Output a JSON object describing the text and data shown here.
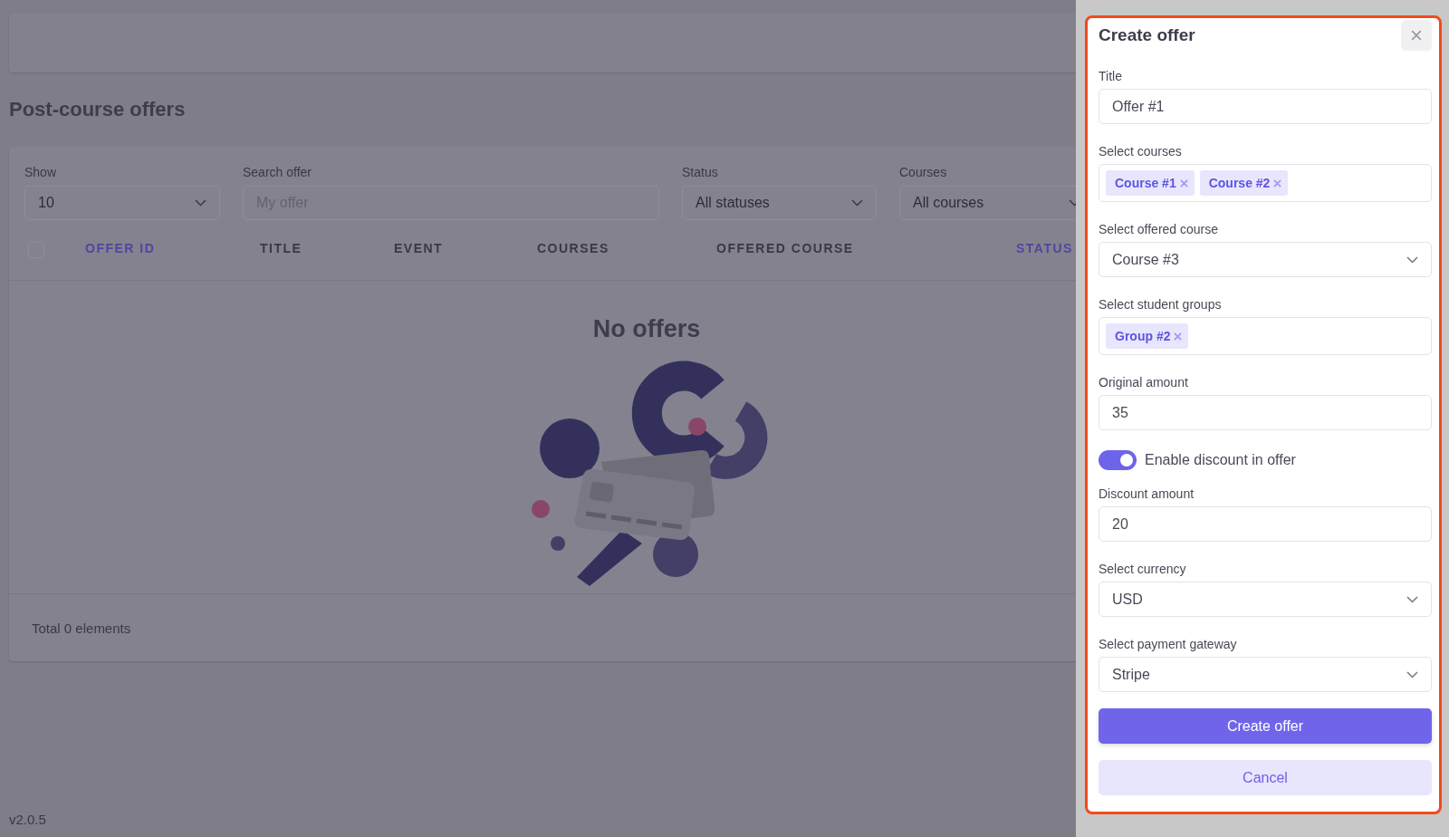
{
  "page": {
    "title": "Post-course offers",
    "filters": [
      {
        "label": "Show",
        "kind": "select",
        "value": "10"
      },
      {
        "label": "Search offer",
        "kind": "text",
        "placeholder": "My offer"
      },
      {
        "label": "Status",
        "kind": "select",
        "value": "All statuses"
      },
      {
        "label": "Courses",
        "kind": "select",
        "value": "All courses"
      }
    ],
    "table": {
      "select_all": {
        "checked": false
      },
      "columns": [
        {
          "label": "OFFER ID",
          "highlighted": true
        },
        {
          "label": "TITLE",
          "highlighted": false
        },
        {
          "label": "EVENT",
          "highlighted": false
        },
        {
          "label": "COURSES",
          "highlighted": false
        },
        {
          "label": "OFFERED COURSE",
          "highlighted": false
        },
        {
          "label": "STATUS",
          "highlighted": true
        }
      ],
      "empty_title": "No offers"
    },
    "footer": "Total 0 elements",
    "version": "v2.0.5"
  },
  "drawer": {
    "title": "Create offer",
    "fields": [
      {
        "kind": "text",
        "label": "Title",
        "value": "Offer #1"
      },
      {
        "kind": "tags",
        "label": "Select courses",
        "tags": [
          "Course #1",
          "Course #2"
        ]
      },
      {
        "kind": "select",
        "label": "Select offered course",
        "value": "Course #3"
      },
      {
        "kind": "tags",
        "label": "Select student groups",
        "tags": [
          "Group #2"
        ]
      },
      {
        "kind": "text",
        "label": "Original amount",
        "value": "35"
      },
      {
        "kind": "toggle",
        "label": "Enable discount in offer",
        "on": true
      },
      {
        "kind": "text",
        "label": "Discount amount",
        "value": "20"
      },
      {
        "kind": "select",
        "label": "Select currency",
        "value": "USD"
      },
      {
        "kind": "select",
        "label": "Select payment gateway",
        "value": "Stripe"
      }
    ],
    "buttons": [
      {
        "label": "Create offer",
        "kind": "primary"
      },
      {
        "label": "Cancel",
        "kind": "secondary"
      }
    ]
  }
}
